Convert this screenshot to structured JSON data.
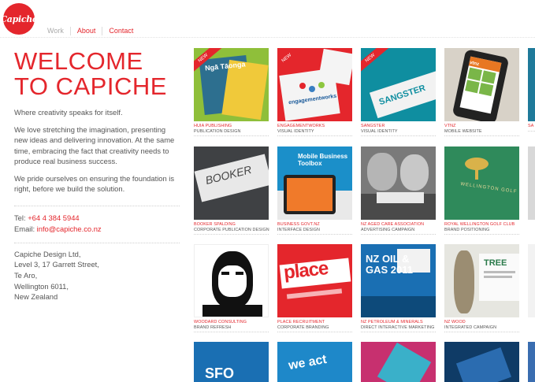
{
  "brand": {
    "logo_text": "Capiche",
    "accent": "#e4262c"
  },
  "nav": {
    "items": [
      "Work",
      "About",
      "Contact"
    ]
  },
  "intro": {
    "welcome_line1": "WELCOME",
    "welcome_line2": "TO CAPICHE",
    "tagline": "Where creativity speaks for itself.",
    "para1": "We love stretching the imagination, presenting new ideas and delivering innovation. At the same time, embracing the fact that creativity needs to produce real business success.",
    "para2": "We pride ourselves on ensuring the foundation is right, before we build the solution."
  },
  "contact": {
    "tel_label": "Tel:",
    "tel": "+64 4 384 5944",
    "email_label": "Email:",
    "email": "info@capiche.co.nz"
  },
  "address": [
    "Capiche Design Ltd,",
    "Level 3, 17 Garrett Street,",
    "Te Aro,",
    "Wellington 6011,",
    "New Zealand"
  ],
  "portfolio": [
    {
      "client": "HUIA PUBLISHING",
      "service": "PUBLICATION DESIGN",
      "badge": "NEW",
      "art_text": "Ngā Tāonga"
    },
    {
      "client": "ENGAGEMENTWORKS",
      "service": "VISUAL IDENTITY",
      "badge": "NEW",
      "art_text": "engagementworks"
    },
    {
      "client": "SANGSTER",
      "service": "VISUAL IDENTITY",
      "badge": "NEW",
      "art_text": "SANGSTER"
    },
    {
      "client": "VTNZ",
      "service": "MOBILE WEBSITE",
      "badge": "",
      "art_text": "vtnz"
    },
    {
      "client": "SA",
      "service": "",
      "badge": "",
      "art_text": ""
    },
    {
      "client": "BOOKER SPALDING",
      "service": "CORPORATE PUBLICATION DESIGN",
      "badge": "",
      "art_text": "BOOKER"
    },
    {
      "client": "BUSINESS GOVT.NZ",
      "service": "INTERFACE DESIGN",
      "badge": "",
      "art_text": "Mobile Business Toolbox"
    },
    {
      "client": "NZ AGED CARE ASSOCIATION",
      "service": "ADVERTISING CAMPAIGN",
      "badge": "",
      "art_text": ""
    },
    {
      "client": "ROYAL WELLINGTON GOLF CLUB",
      "service": "BRAND POSITIONING",
      "badge": "",
      "art_text": "WELLINGTON GOLF"
    },
    {
      "client": "",
      "service": "",
      "badge": "",
      "art_text": ""
    },
    {
      "client": "WOODARD CONSULTING",
      "service": "BRAND REFRESH",
      "badge": "",
      "art_text": ""
    },
    {
      "client": "PLACE RECRUITMENT",
      "service": "CORPORATE BRANDING",
      "badge": "",
      "art_text": "place"
    },
    {
      "client": "NZ PETROLEUM & MINERALS",
      "service": "DIRECT INTERACTIVE MARKETING",
      "badge": "",
      "art_text": "NZ OIL & GAS 2011"
    },
    {
      "client": "NZ WOOD",
      "service": "INTEGRATED CAMPAIGN",
      "badge": "",
      "art_text": "TREE"
    },
    {
      "client": "",
      "service": "",
      "badge": "",
      "art_text": ""
    },
    {
      "client": "",
      "service": "",
      "badge": "",
      "art_text": "SFO"
    },
    {
      "client": "",
      "service": "",
      "badge": "",
      "art_text": "we act"
    },
    {
      "client": "",
      "service": "",
      "badge": "",
      "art_text": ""
    },
    {
      "client": "",
      "service": "",
      "badge": "",
      "art_text": ""
    },
    {
      "client": "",
      "service": "",
      "badge": "",
      "art_text": ""
    }
  ]
}
